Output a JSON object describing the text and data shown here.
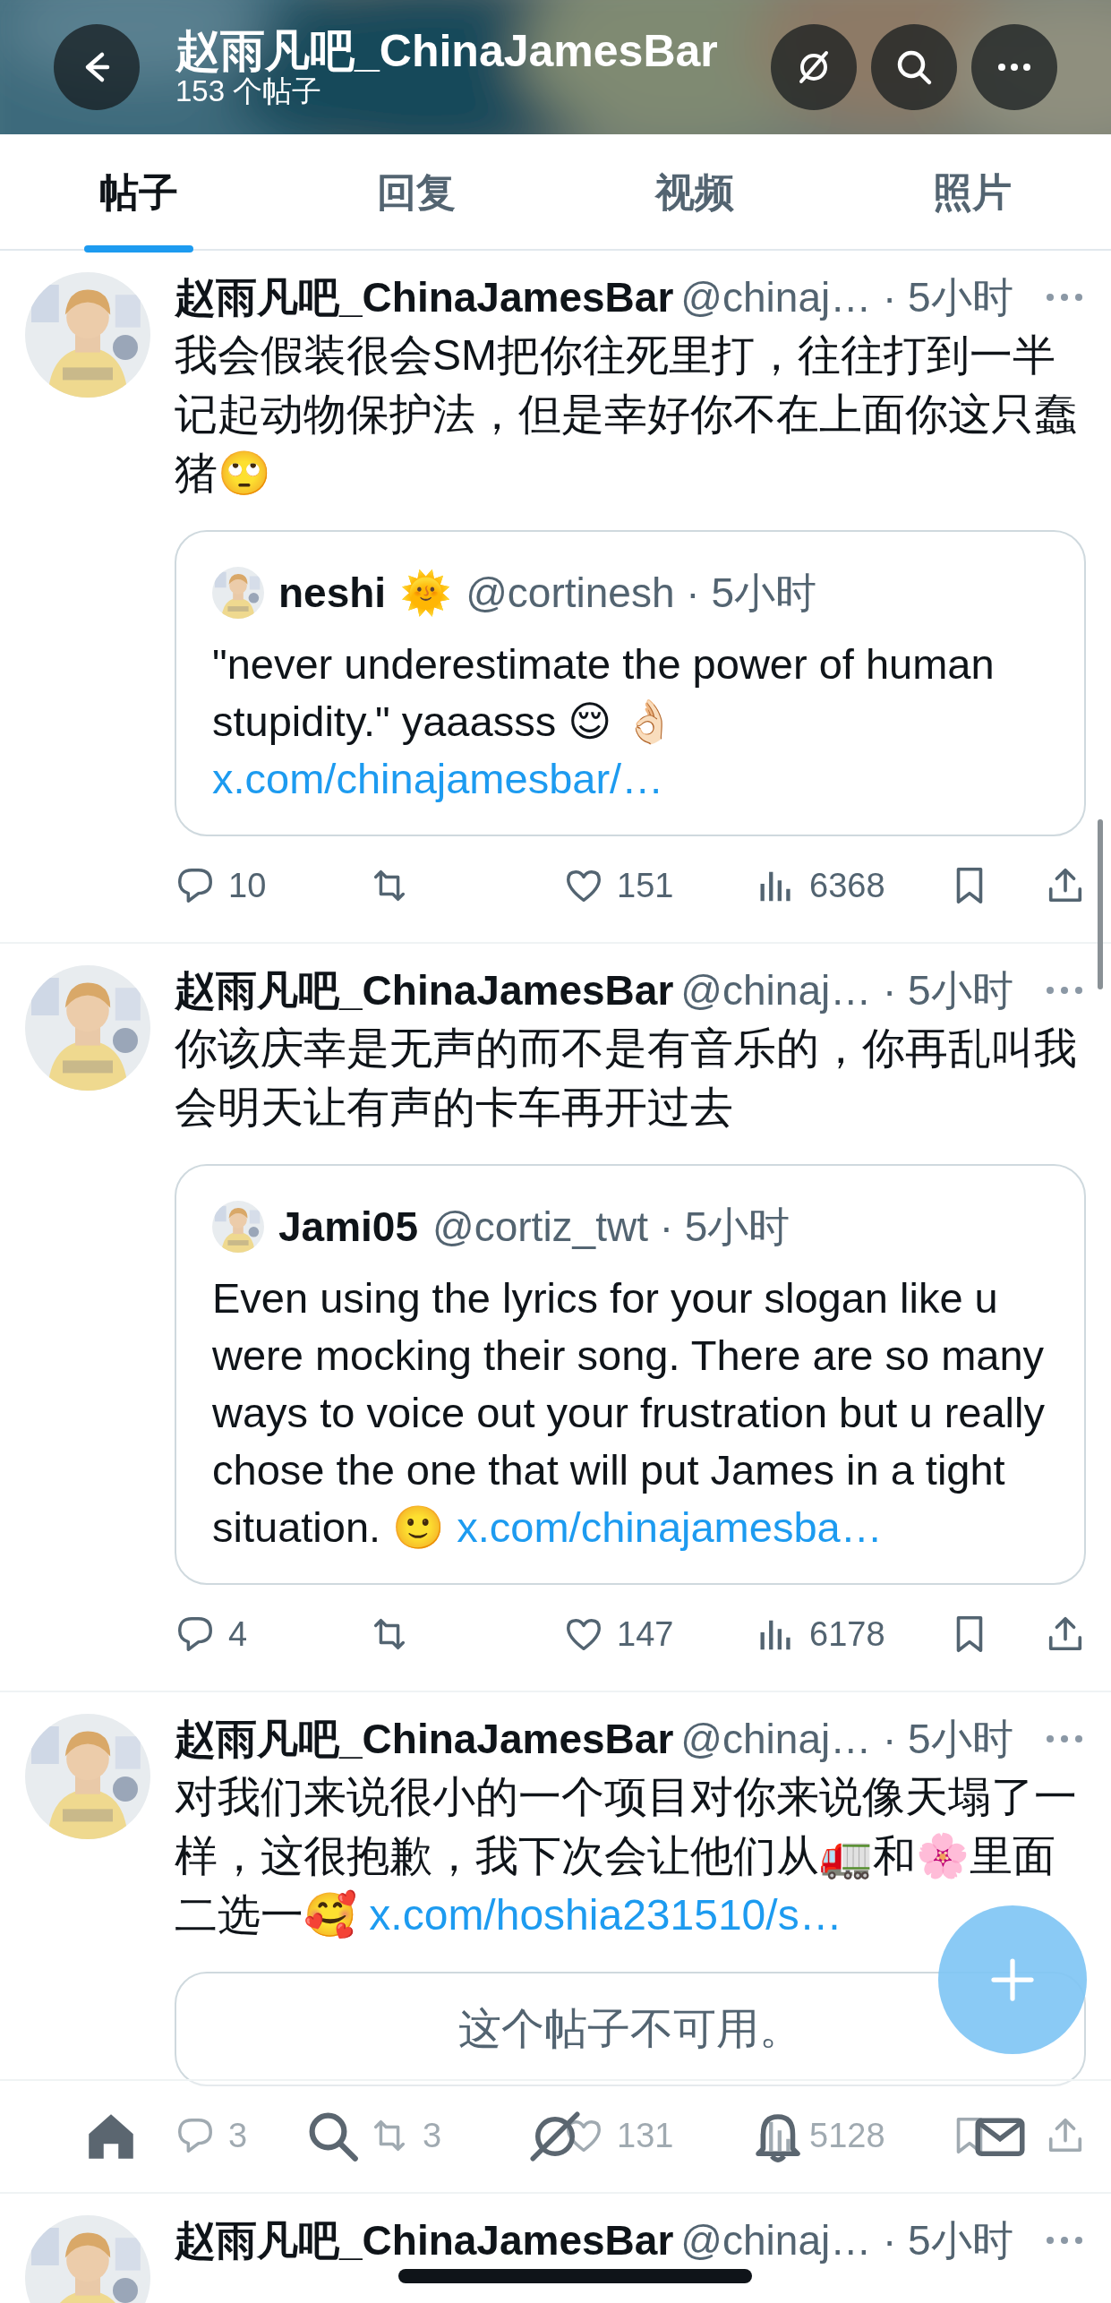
{
  "header": {
    "title": "赵雨凡吧_ChinaJamesBar",
    "subtitle": "153 个帖子"
  },
  "tabs": [
    {
      "label": "帖子",
      "selected": true
    },
    {
      "label": "回复",
      "selected": false
    },
    {
      "label": "视频",
      "selected": false
    },
    {
      "label": "照片",
      "selected": false
    }
  ],
  "posts": [
    {
      "author": "赵雨凡吧_ChinaJamesBar",
      "meta": "@chinaj… · 5小时",
      "body": "我会假装很会SM把你往死里打，往往打到一半记起动物保护法，但是幸好你不在上面你这只蠢猪🙄",
      "quote": {
        "kind": "post",
        "author": "neshi",
        "badge": "🌞",
        "meta": "@cortinesh · 5小时",
        "body": "\"never underestimate the power of human stupidity.\" yaaasss 😌 👌🏻",
        "link": "x.com/chinajamesbar/…"
      },
      "stats": {
        "replies": "10",
        "likes": "151",
        "views": "6368"
      }
    },
    {
      "author": "赵雨凡吧_ChinaJamesBar",
      "meta": "@chinaj… · 5小时",
      "body": "你该庆幸是无声的而不是有音乐的，你再乱叫我会明天让有声的卡车再开过去",
      "quote": {
        "kind": "post",
        "author": "Jami05",
        "meta": "@cortiz_twt · 5小时",
        "body": "Even using the lyrics for your slogan like u were mocking their song. There are so many ways to voice out your frustration but u really chose the one that will put James in a tight situation. 🙂",
        "link": "x.com/chinajamesba…"
      },
      "stats": {
        "replies": "4",
        "likes": "147",
        "views": "6178"
      }
    },
    {
      "author": "赵雨凡吧_ChinaJamesBar",
      "meta": "@chinaj… · 5小时",
      "body": "对我们来说很小的一个项目对你来说像天塌了一样，这很抱歉，我下次会让他们从🚛和🌸里面二选一🥰",
      "link": "x.com/hoshia231510/s…",
      "quote": {
        "kind": "unavailable",
        "notice": "这个帖子不可用。"
      },
      "stats": {
        "replies": "3",
        "reposts": "3",
        "likes": "131",
        "views": "5128"
      }
    },
    {
      "author": "赵雨凡吧_ChinaJamesBar",
      "meta": "@chinaj… · 5小时"
    }
  ]
}
